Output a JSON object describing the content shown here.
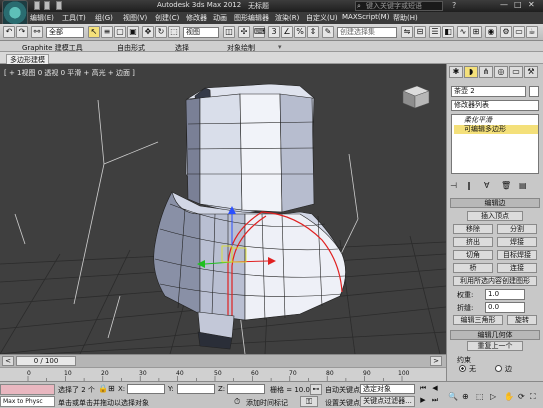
{
  "app": {
    "title": "Autodesk 3ds Max  2012",
    "document": "无标题",
    "search_placeholder": "键入关键字或短语"
  },
  "menu": [
    "编辑(E)",
    "工具(T)",
    "组(G)",
    "视图(V)",
    "创建(C)",
    "修改器",
    "动画",
    "图形编辑器",
    "渲染(R)",
    "自定义(U)",
    "MAXScript(M)",
    "帮助(H)"
  ],
  "toolbar": {
    "filter_value": "全部",
    "view_value": "视图",
    "selection_set_placeholder": "创建选择集"
  },
  "ribbon": {
    "tabs": [
      "Graphite 建模工具",
      "自由形式",
      "选择",
      "对象绘制"
    ],
    "subtab": "多边形建模"
  },
  "viewport": {
    "label": "[ + 1视图 0 透视 0 平滑 + 高光 + 边面 ]"
  },
  "command_panel": {
    "tabs": [
      "create-icon",
      "modify-icon",
      "hierarchy-icon",
      "motion-icon",
      "display-icon",
      "utilities-icon"
    ],
    "object_name": "茶壶 2",
    "modifier_list": "修改器列表",
    "stack": [
      "柔化平滑",
      "可编辑多边形"
    ],
    "edit_edges_rollout": "编辑边",
    "buttons": {
      "insert_vertex": "插入顶点",
      "remove": "移除",
      "split": "分割",
      "extrude": "挤出",
      "weld": "焊接",
      "chamfer": "切角",
      "target_weld": "目标焊接",
      "bridge": "桥",
      "connect": "连接",
      "create_shape": "利用所选内容创建图形",
      "edit_tri": "编辑三角形",
      "turn": "旋转"
    },
    "weight_label": "权重:",
    "weight_value": "1.0",
    "crease_label": "折缝:",
    "crease_value": "0.0",
    "edit_geometry_rollout": "编辑几何体",
    "repeat_last": "重复上一个",
    "constraints_label": "约束",
    "constraint_none": "无",
    "constraint_edge": "边"
  },
  "timeline": {
    "frame": "0 / 100",
    "ticks": [
      "0",
      "10",
      "20",
      "30",
      "40",
      "50",
      "60",
      "70",
      "80",
      "90",
      "100"
    ]
  },
  "status": {
    "selected": "选择了 2 个",
    "hint": "单击或单击并拖动以选择对象",
    "x_label": "X:",
    "y_label": "Y:",
    "z_label": "Z:",
    "grid": "栅格 = 10.0",
    "auto_key": "自动关键点",
    "selected_object": "选定对象",
    "set_key": "设置关键点",
    "key_filters": "关键点过滤器...",
    "add_time_tag": "添加时间标记",
    "script": "Max to Physc"
  },
  "colors": {
    "viewport_bg": "#3f3f3f",
    "mesh_light": "#e8ecf7",
    "mesh_mid": "#aab0c4",
    "mesh_dark": "#4d5264",
    "selected_edge": "#e02020",
    "grid": "#2a2a2a"
  }
}
